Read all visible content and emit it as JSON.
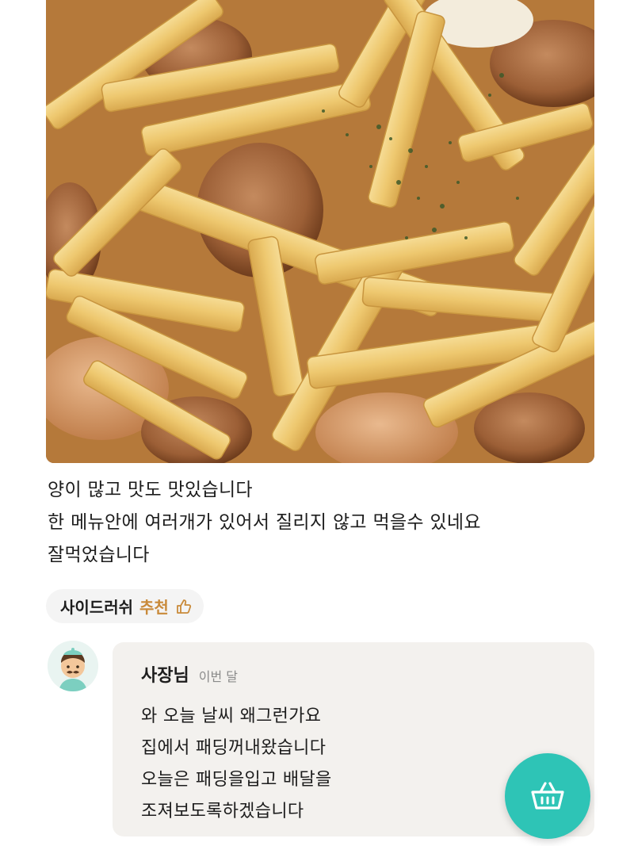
{
  "review": {
    "photo_alt": "food-photo",
    "lines": [
      "양이 많고 맛도 맛있습니다",
      "한 메뉴안에 여러개가 있어서 질리지 않고 먹을수 있네요",
      "잘먹었습니다"
    ]
  },
  "menu_tag": {
    "name": "사이드러쉬",
    "recommend": "추천",
    "icon": "thumbs-up-icon"
  },
  "owner_reply": {
    "author": "사장님",
    "date": "이번 달",
    "avatar_icon": "owner-avatar-icon",
    "lines": [
      "와 오늘 날씨 왜그런가요",
      "집에서 패딩꺼내왔습니다",
      "오늘은 패딩을입고 배달을",
      "조져보도록하겠습니다"
    ]
  },
  "cart_button": {
    "icon": "basket-icon"
  },
  "colors": {
    "accent": "#2ec4b6",
    "recommend": "#c98a3a",
    "reply_bg": "#f3f1ee",
    "chip_bg": "#f4f4f4"
  }
}
